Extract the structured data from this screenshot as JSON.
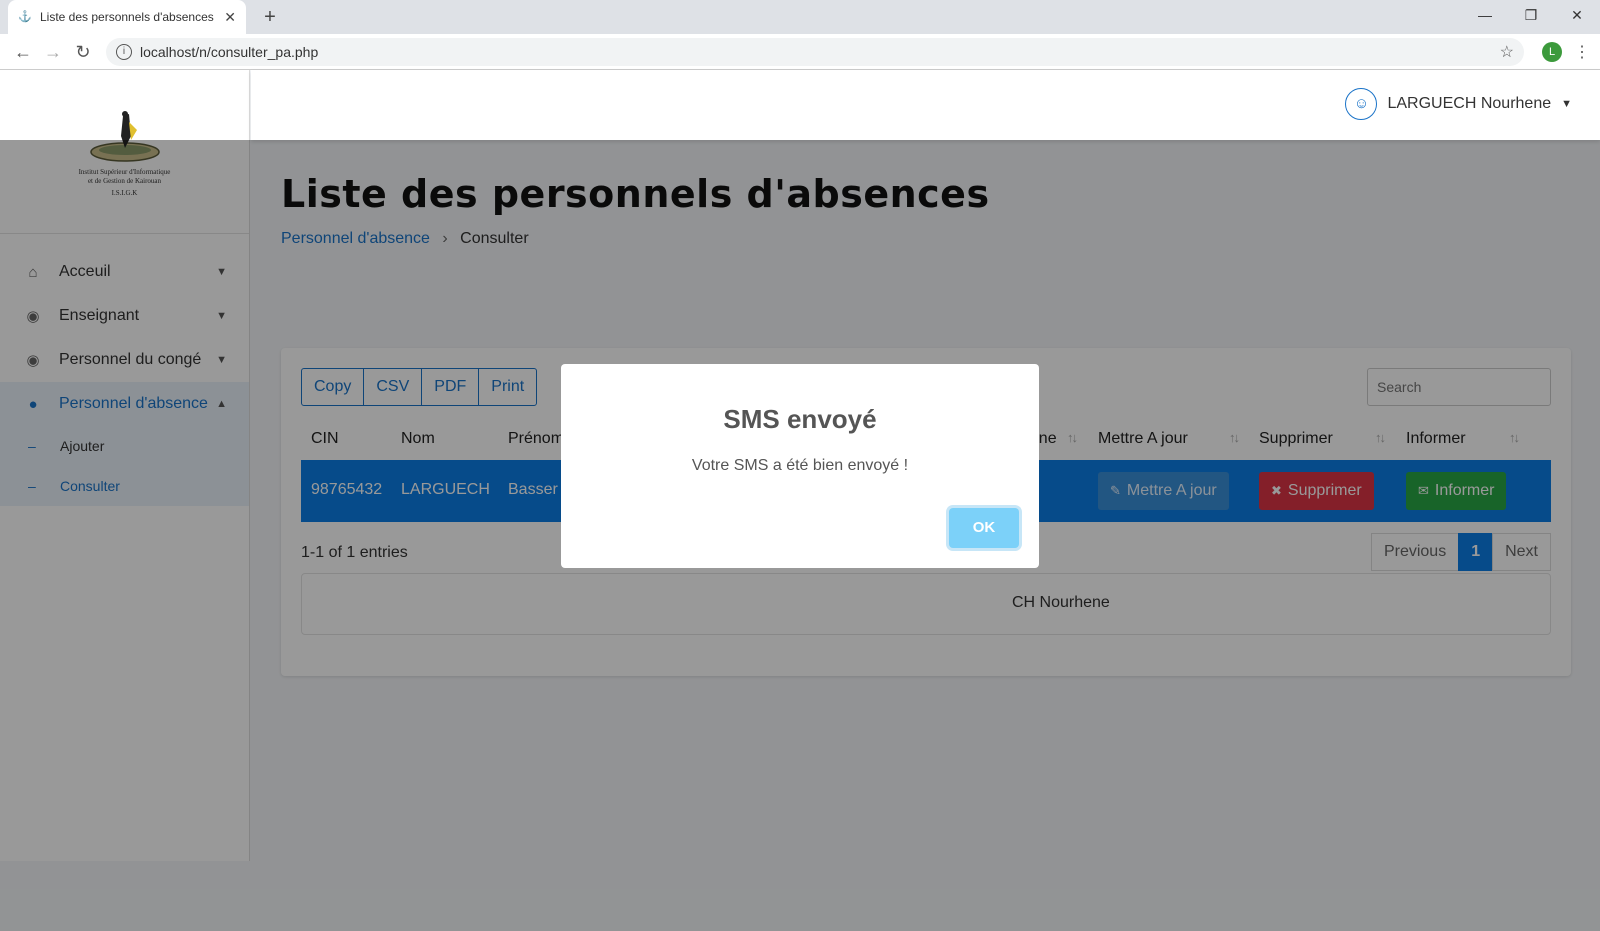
{
  "browser": {
    "tab_title": "Liste des personnels d'absences",
    "tab_close": "✕",
    "new_tab": "+",
    "url": "localhost/n/consulter_pa.php",
    "profile_letter": "L"
  },
  "logo": {
    "line1": "Institut Supérieur d'Informatique",
    "line2": "et de Gestion de Kairouan",
    "line3": "I.S.I.G.K"
  },
  "sidebar": {
    "items": [
      {
        "label": "Acceuil",
        "icon": "home-icon"
      },
      {
        "label": "Enseignant",
        "icon": "user-circle-icon"
      },
      {
        "label": "Personnel du congé",
        "icon": "user-circle-icon"
      },
      {
        "label": "Personnel d'absence",
        "icon": "user-icon",
        "active": true
      }
    ],
    "sub_items": [
      {
        "label": "Ajouter"
      },
      {
        "label": "Consulter",
        "current": true
      }
    ]
  },
  "header": {
    "user_name": "LARGUECH Nourhene"
  },
  "page": {
    "title": "Liste des personnels d'absences",
    "breadcrumb_parent": "Personnel d'absence",
    "breadcrumb_current": "Consulter"
  },
  "table": {
    "export_buttons": [
      "Copy",
      "CSV",
      "PDF",
      "Print"
    ],
    "search_placeholder": "Search",
    "columns": [
      "CIN",
      "Nom",
      "Prénom",
      "hone",
      "Mettre A jour",
      "Supprimer",
      "Informer"
    ],
    "row": {
      "cin": "98765432",
      "nom": "LARGUECH",
      "prenom": "Basser",
      "btn_update": "Mettre A jour",
      "btn_delete": "Supprimer",
      "btn_inform": "Informer"
    },
    "info": "1-1 of 1 entries",
    "pager": {
      "prev": "Previous",
      "page": "1",
      "next": "Next"
    },
    "footer_text": "CH Nourhene"
  },
  "modal": {
    "title": "SMS envoyé",
    "text": "Votre SMS a été bien envoyé !",
    "ok": "OK"
  },
  "colors": {
    "primary": "#0a7de6",
    "danger": "#dc3545",
    "success": "#28a745",
    "ok": "#7cd1f9"
  }
}
